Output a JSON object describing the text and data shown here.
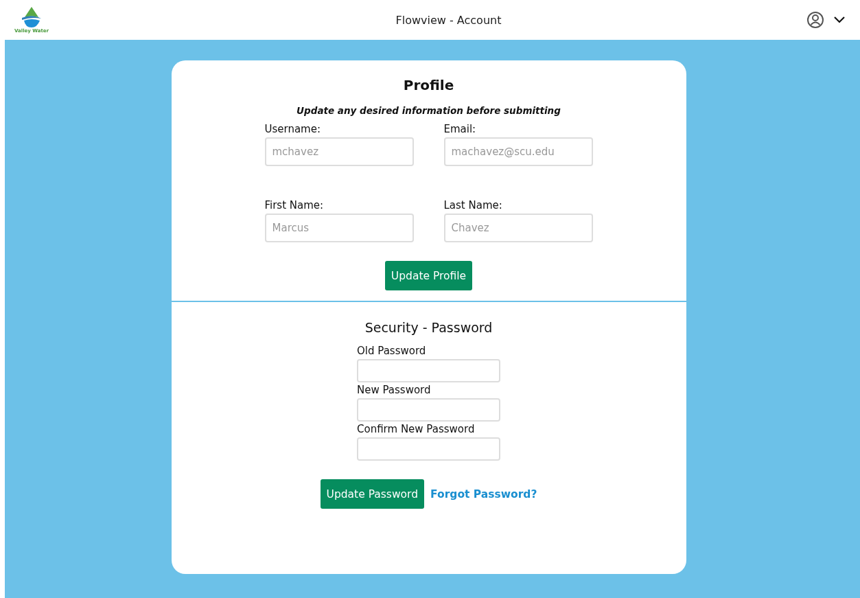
{
  "header": {
    "logo_text": "Valley Water",
    "title": "Flowview - Account"
  },
  "profile": {
    "title": "Profile",
    "subtitle": "Update any desired information before submitting",
    "fields": [
      {
        "label": "Username:",
        "placeholder": "mchavez"
      },
      {
        "label": "Email:",
        "placeholder": "machavez@scu.edu"
      },
      {
        "label": "First Name:",
        "placeholder": "Marcus"
      },
      {
        "label": "Last Name:",
        "placeholder": "Chavez"
      }
    ],
    "button": "Update Profile"
  },
  "security": {
    "title": "Security - Password",
    "fields": [
      {
        "label": "Old Password"
      },
      {
        "label": "New Password"
      },
      {
        "label": "Confirm New Password"
      }
    ],
    "button": "Update Password",
    "link": "Forgot Password?"
  }
}
